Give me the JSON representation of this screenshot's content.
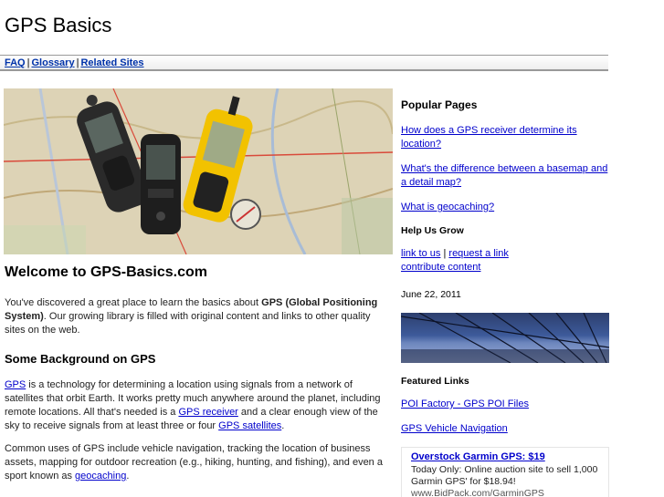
{
  "site": {
    "title": "GPS Basics"
  },
  "nav": {
    "items": [
      "FAQ",
      "Glossary",
      "Related Sites"
    ]
  },
  "main": {
    "heading": "Welcome to GPS-Basics.com",
    "intro_pre": "You've discovered a great place to learn the basics about ",
    "intro_bold": "GPS (Global Positioning System)",
    "intro_post": ". Our growing library is filled with original content and links to other quality sites on the web.",
    "background_heading": "Some Background on GPS",
    "p2_link1": "GPS",
    "p2_a": " is a technology for determining a location using signals from a network of satellites that orbit Earth. It works pretty much anywhere around the planet, including remote locations. All that's needed is a ",
    "p2_link2": "GPS receiver",
    "p2_b": " and a clear enough view of the sky to receive signals from at least three or four ",
    "p2_link3": "GPS satellites",
    "p2_c": ".",
    "p3_a": "Common uses of GPS include vehicle navigation, tracking the location of business assets, mapping for outdoor recreation (e.g., hiking, hunting, and fishing), and even a sport known as ",
    "p3_link": "geocaching",
    "p3_b": "."
  },
  "sidebar": {
    "popular_heading": "Popular Pages",
    "popular_links": [
      "How does a GPS receiver determine its location?",
      "What's the difference between a basemap and a detail map?",
      "What is geocaching?"
    ],
    "help_heading": "Help Us Grow",
    "help_link1": "link to us",
    "help_sep": " | ",
    "help_link2": "request a link",
    "help_link3": "contribute content",
    "date": "June 22, 2011",
    "featured_heading": "Featured Links",
    "featured_links": [
      "POI Factory - GPS POI Files",
      "GPS Vehicle Navigation"
    ],
    "ad": {
      "title": "Overstock Garmin GPS: $19",
      "text": "Today Only: Online auction site to sell 1,000 Garmin GPS' for $18.94!",
      "url": "www.BidPack.com/GarminGPS"
    }
  },
  "colors": {
    "link": "#0000cc",
    "nav_link": "#0033aa",
    "device_yellow": "#f2c200"
  }
}
